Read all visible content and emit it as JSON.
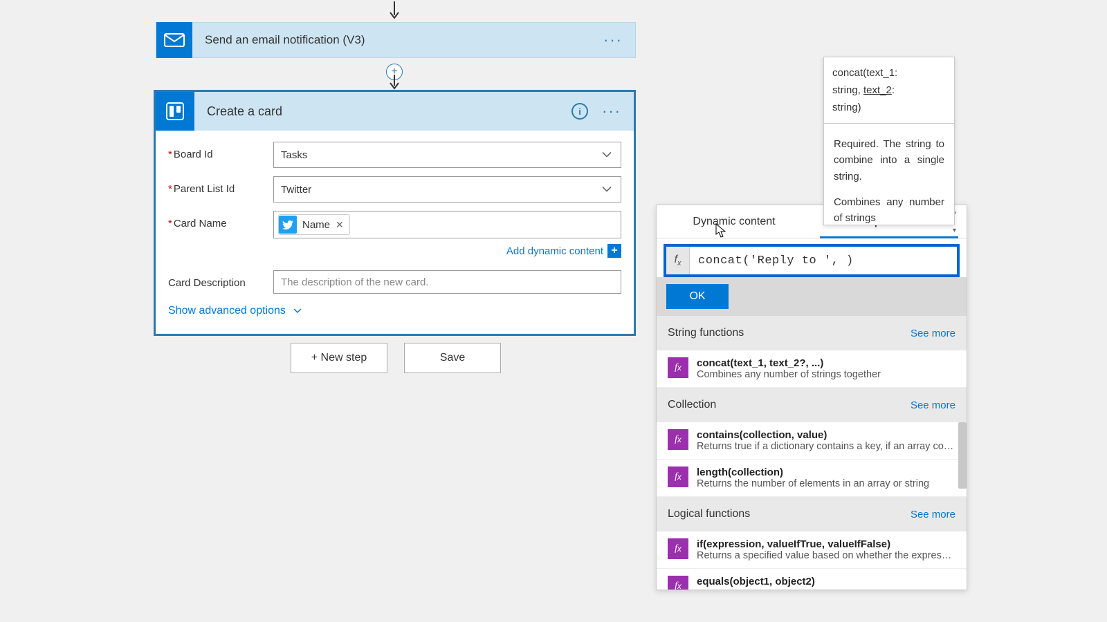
{
  "flow": {
    "email_card_title": "Send an email notification (V3)",
    "trello_card_title": "Create a card",
    "fields": {
      "board_id": {
        "label": "Board Id",
        "value": "Tasks",
        "required": true
      },
      "parent_list_id": {
        "label": "Parent List Id",
        "value": "Twitter",
        "required": true
      },
      "card_name": {
        "label": "Card Name",
        "token": "Name",
        "required": true
      },
      "card_description": {
        "label": "Card Description",
        "placeholder": "The description of the new card."
      }
    },
    "add_dynamic_content": "Add dynamic content",
    "show_advanced": "Show advanced options",
    "new_step_btn": "+ New step",
    "save_btn": "Save"
  },
  "tooltip": {
    "signature_line1": "concat(text_1:",
    "signature_line2_a": "string, ",
    "signature_line2_b": "text_2",
    "signature_line2_c": ":",
    "signature_line3": "string)",
    "desc1": "Required. The string to combine into a single string.",
    "desc2": "Combines any number of strings"
  },
  "expr": {
    "tab_dynamic": "Dynamic content",
    "tab_expression": "Expression",
    "input_value": "concat('Reply to ', )",
    "ok_label": "OK",
    "see_more": "See more",
    "sections": {
      "string": "String functions",
      "collection": "Collection",
      "logical": "Logical functions"
    },
    "funcs": {
      "concat_sig": "concat(text_1, text_2?, ...)",
      "concat_desc": "Combines any number of strings together",
      "contains_sig": "contains(collection, value)",
      "contains_desc": "Returns true if a dictionary contains a key, if an array cont...",
      "length_sig": "length(collection)",
      "length_desc": "Returns the number of elements in an array or string",
      "if_sig": "if(expression, valueIfTrue, valueIfFalse)",
      "if_desc": "Returns a specified value based on whether the expressio...",
      "equals_sig": "equals(object1, object2)"
    }
  }
}
